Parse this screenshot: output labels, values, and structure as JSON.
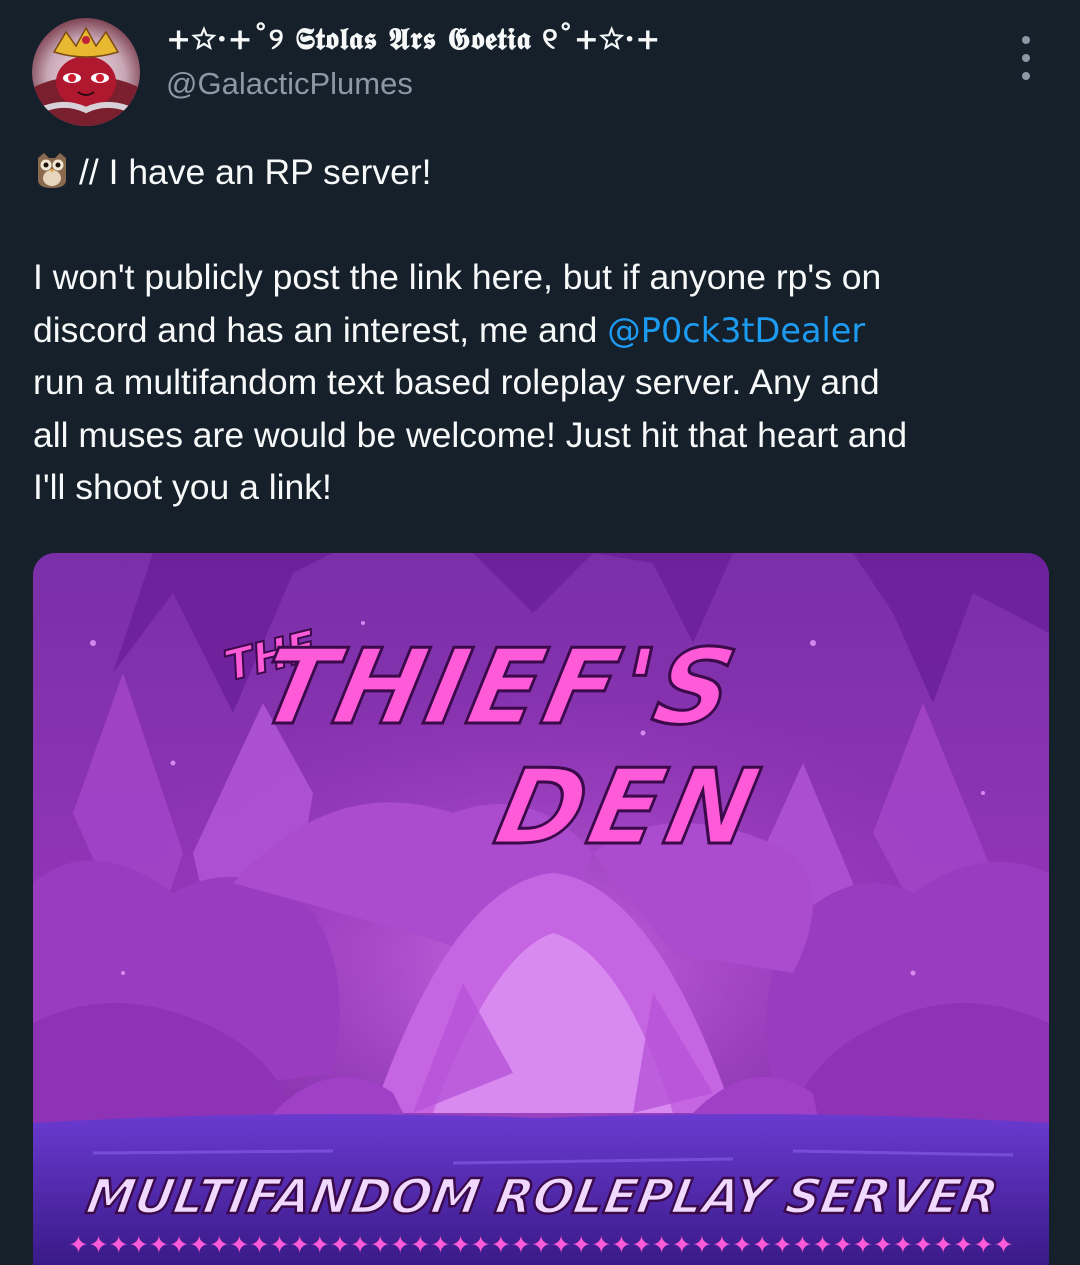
{
  "author": {
    "display_name": "+☆·+˚୨ 𝕾𝖙𝖔𝖑𝖆𝖘 𝕬𝖗𝖘 𝕲𝖔𝖊𝖙𝖎𝖆 ୧˚+☆·+",
    "handle": "@GalacticPlumes",
    "avatar_icon": "stolas-avatar"
  },
  "menu": {
    "icon": "more-icon"
  },
  "tweet": {
    "line1": "// I have an RP server!",
    "line1_icon": "owl-icon",
    "body_lines": [
      "I won't publicly post the link here, but if anyone rp's on",
      "discord and has an interest, me and ",
      "run a multifandom text based roleplay server. Any and",
      "all muses are would be welcome! Just hit that heart and",
      "I'll shoot you a link!"
    ],
    "mention": "@P0ck3tDealer"
  },
  "media": {
    "title_small": "THE",
    "title_line1": "THIEF'S",
    "title_line2": "DEN",
    "subtitle": "MULTIFANDOM ROLEPLAY SERVER",
    "star_row": "✦✦✦✦✦✦✦✦✦✦✦✦✦✦✦✦✦✦✦✦✦✦✦✦✦✦✦✦✦✦✦✦✦✦✦✦✦✦✦✦✦✦✦✦✦✦✦"
  },
  "colors": {
    "background": "#15202b",
    "text": "#f7f9f9",
    "secondary": "#8b98a5",
    "link": "#1d9bf0",
    "art_pink": "#ff4fd8",
    "art_purple": "#8a2fb8"
  }
}
